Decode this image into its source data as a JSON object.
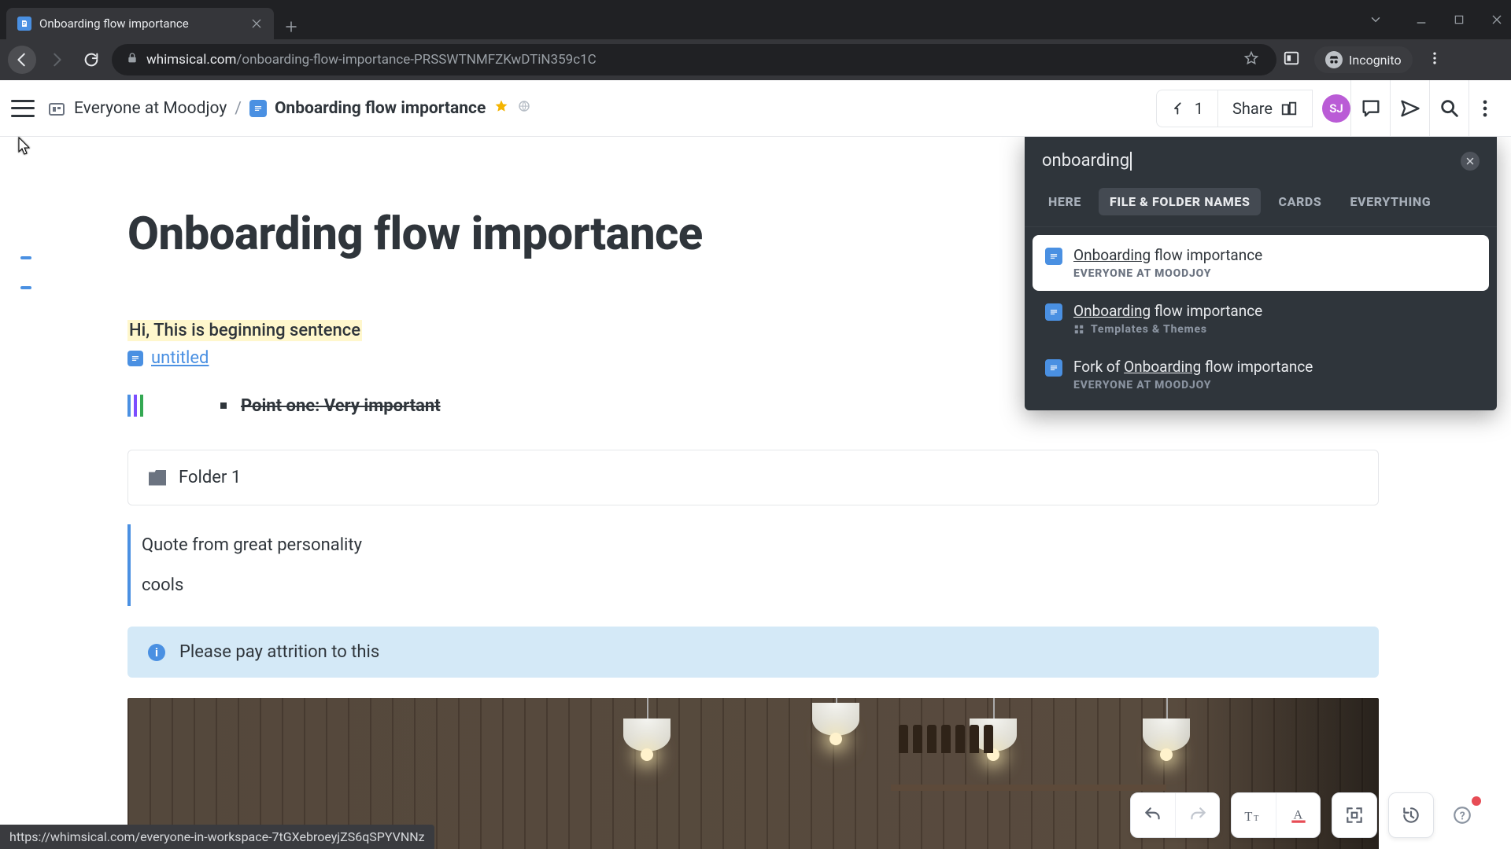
{
  "browser": {
    "tab_title": "Onboarding flow importance",
    "url_host": "whimsical.com",
    "url_path": "/onboarding-flow-importance-PRSSWTNMFZKwDTiN359c1C",
    "incognito_label": "Incognito"
  },
  "header": {
    "workspace": "Everyone at Moodjoy",
    "doc_title": "Onboarding flow importance",
    "visitors": "1",
    "share_label": "Share",
    "avatar_initials": "SJ"
  },
  "doc": {
    "title": "Onboarding flow importance",
    "highlight_sentence": "Hi, This is beginning sentence",
    "subdoc_label": "untitled",
    "point_one": "Point one: Very important",
    "folder_label": "Folder 1",
    "quote_line1": "Quote from great personality",
    "quote_line2": "cools",
    "info_text": "Please pay attrition to this"
  },
  "search": {
    "query": "onboarding",
    "close_aria": "Close search",
    "tabs": {
      "here": "HERE",
      "names": "FILE & FOLDER NAMES",
      "cards": "CARDS",
      "everything": "EVERYTHING"
    },
    "results": [
      {
        "title_hl": "Onboarding",
        "title_rest": " flow importance",
        "subtitle": "EVERYONE AT MOODJOY",
        "icon": "doc"
      },
      {
        "title_hl": "Onboarding",
        "title_rest": " flow importance",
        "subtitle": "Templates & Themes",
        "icon": "doc",
        "sub_icon": "templates"
      },
      {
        "title_pre": "Fork of ",
        "title_hl": "Onboarding",
        "title_rest": " flow importance",
        "subtitle": "EVERYONE AT MOODJOY",
        "icon": "doc"
      }
    ]
  },
  "status_url": "https://whimsical.com/everyone-in-workspace-7tGXebroeyjZS6qSPYVNNz"
}
